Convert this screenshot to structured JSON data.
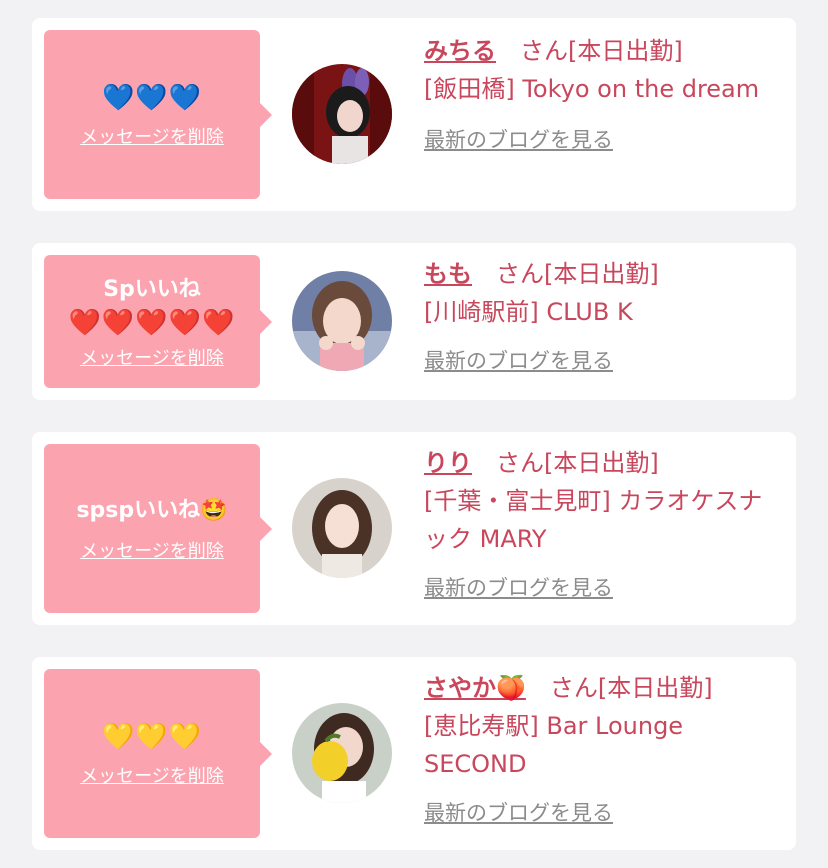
{
  "common": {
    "delete_label": "メッセージを削除",
    "blog_label": "最新のブログを見る",
    "attendance_suffix": "さん[本日出勤]"
  },
  "cards": [
    {
      "message": "",
      "emojis": "💙💙💙",
      "name": "みちる",
      "shop": "[飯田橋] Tokyo on the dream"
    },
    {
      "message": "Spいいね",
      "emojis": "❤️❤️❤️❤️❤️",
      "name": "もも",
      "shop": "[川崎駅前] CLUB K"
    },
    {
      "message": "spspいいね🤩",
      "emojis": "",
      "name": "りり",
      "shop": "[千葉・富士見町] カラオケスナック MARY"
    },
    {
      "message": "",
      "emojis": "💛💛💛",
      "name": "さやか🍑",
      "shop": "[恵比寿駅] Bar Lounge SECOND"
    }
  ],
  "colors": {
    "bubble": "#fba4b0",
    "accent_text": "#c9475c",
    "link_gray": "#8c8c8c",
    "background": "#f2f2f4"
  }
}
